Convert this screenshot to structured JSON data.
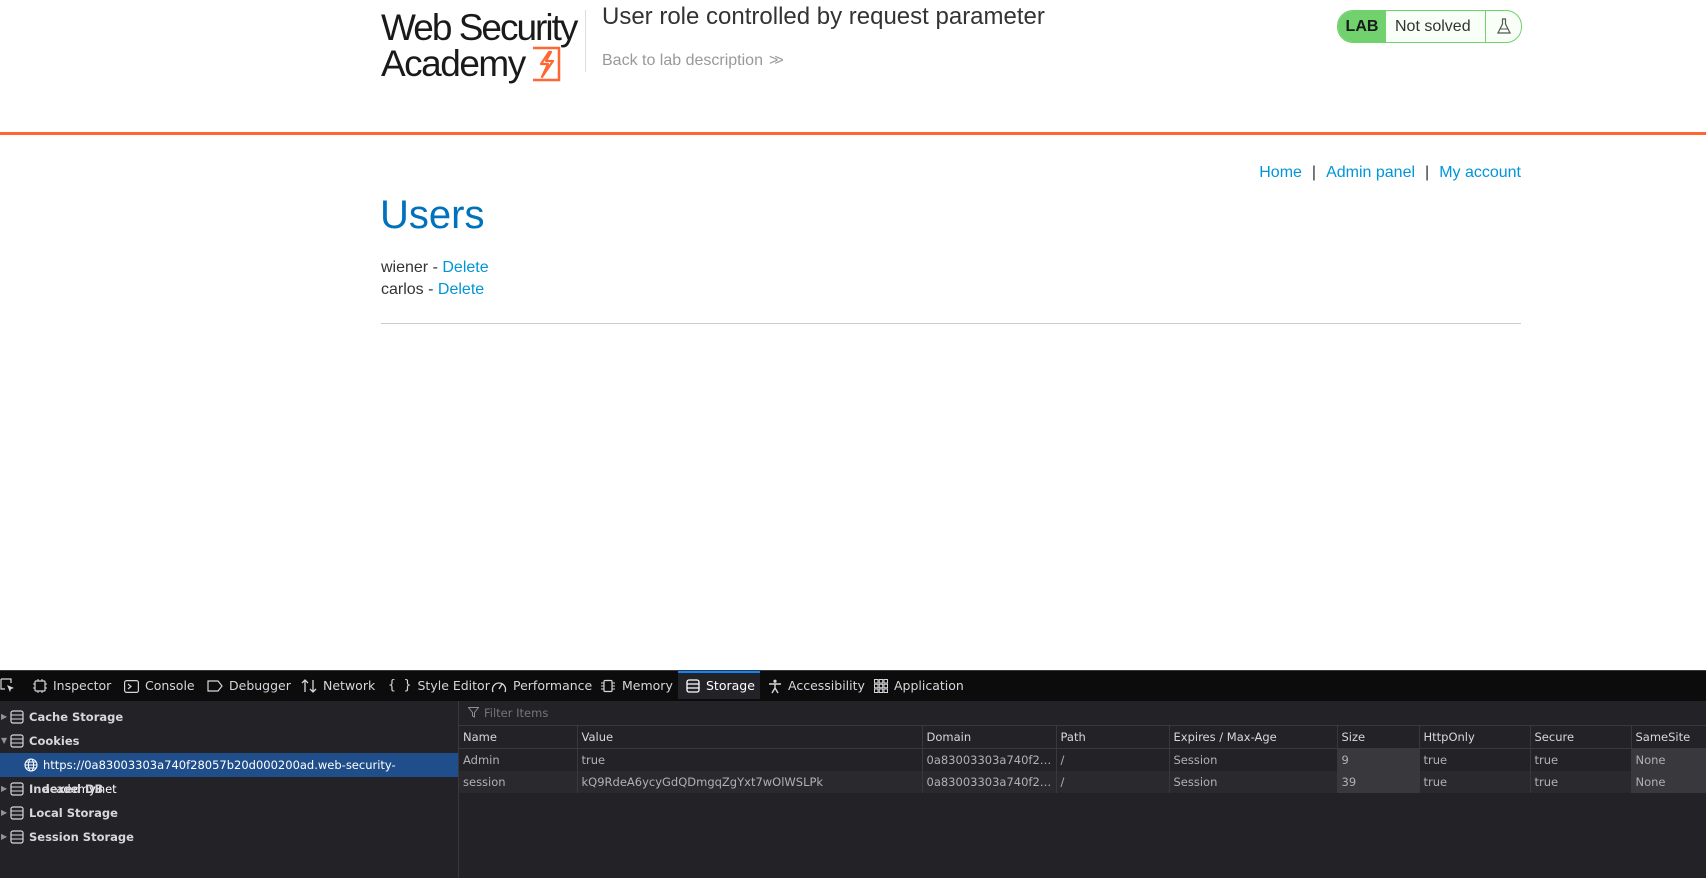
{
  "header": {
    "logo_line1": "Web Security",
    "logo_line2": "Academy",
    "lab_title": "User role controlled by request parameter",
    "back_link": "Back to lab description",
    "lab_badge": "LAB",
    "lab_status": "Not solved"
  },
  "nav": {
    "home": "Home",
    "separator": "|",
    "admin_panel": "Admin panel",
    "my_account": "My account"
  },
  "main": {
    "heading": "Users",
    "users": [
      {
        "name": "wiener",
        "dash": " - ",
        "action": "Delete"
      },
      {
        "name": "carlos",
        "dash": " - ",
        "action": "Delete"
      }
    ]
  },
  "devtools": {
    "tabs": [
      "Inspector",
      "Console",
      "Debugger",
      "Network",
      "Style Editor",
      "Performance",
      "Memory",
      "Storage",
      "Accessibility",
      "Application"
    ],
    "active_tab": "Storage",
    "sidebar": {
      "cache_storage": "Cache Storage",
      "cookies": "Cookies",
      "cookie_origin": "https://0a83003303a740f28057b20d000200ad.web-security-academy.net",
      "indexed_db": "Indexed DB",
      "local_storage": "Local Storage",
      "session_storage": "Session Storage"
    },
    "filter_placeholder": "Filter Items",
    "columns": [
      "Name",
      "Value",
      "Domain",
      "Path",
      "Expires / Max-Age",
      "Size",
      "HttpOnly",
      "Secure",
      "SameSite"
    ],
    "rows": [
      [
        "Admin",
        "true",
        "0a83003303a740f280...",
        "/",
        "Session",
        "9",
        "true",
        "true",
        "None"
      ],
      [
        "session",
        "kQ9RdeA6ycyGdQDmgqZgYxt7wOlWSLPk",
        "0a83003303a740f280...",
        "/",
        "Session",
        "39",
        "true",
        "true",
        "None"
      ]
    ]
  },
  "colors": {
    "brand_orange": "#ff6633",
    "lab_green": "#70d16d",
    "heading_blue": "#0071bc",
    "link_blue": "#0095d9",
    "devtools_bg": "#232327",
    "devtools_selected": "#204e8a",
    "devtools_active_tab": "#0a84ff"
  }
}
